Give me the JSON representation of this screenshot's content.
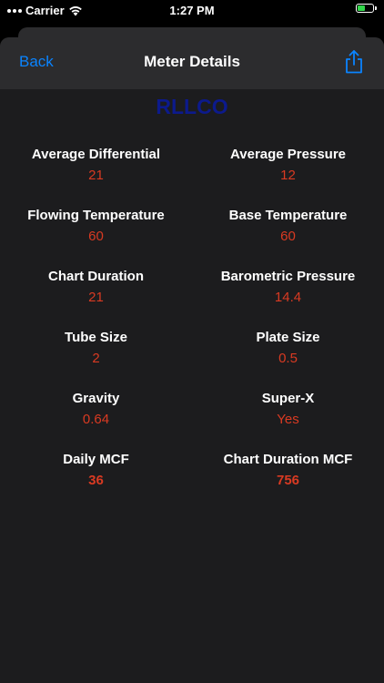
{
  "status_bar": {
    "carrier": "Carrier",
    "time": "1:27 PM",
    "battery_level": 0.5,
    "battery_color": "#32d74b"
  },
  "nav": {
    "back_label": "Back",
    "title": "Meter Details",
    "share_icon": "share-icon"
  },
  "company": "RLLCO",
  "colors": {
    "accent": "#0a84ff",
    "value": "#d93a22",
    "company": "#0c1a8c"
  },
  "fields": [
    {
      "label": "Average Differential",
      "value": "21"
    },
    {
      "label": "Average Pressure",
      "value": "12"
    },
    {
      "label": "Flowing Temperature",
      "value": "60"
    },
    {
      "label": "Base Temperature",
      "value": "60"
    },
    {
      "label": "Chart Duration",
      "value": "21"
    },
    {
      "label": "Barometric Pressure",
      "value": "14.4"
    },
    {
      "label": "Tube Size",
      "value": "2"
    },
    {
      "label": "Plate Size",
      "value": "0.5"
    },
    {
      "label": "Gravity",
      "value": "0.64"
    },
    {
      "label": "Super-X",
      "value": "Yes"
    },
    {
      "label": "Daily MCF",
      "value": "36"
    },
    {
      "label": "Chart Duration MCF",
      "value": "756"
    }
  ]
}
